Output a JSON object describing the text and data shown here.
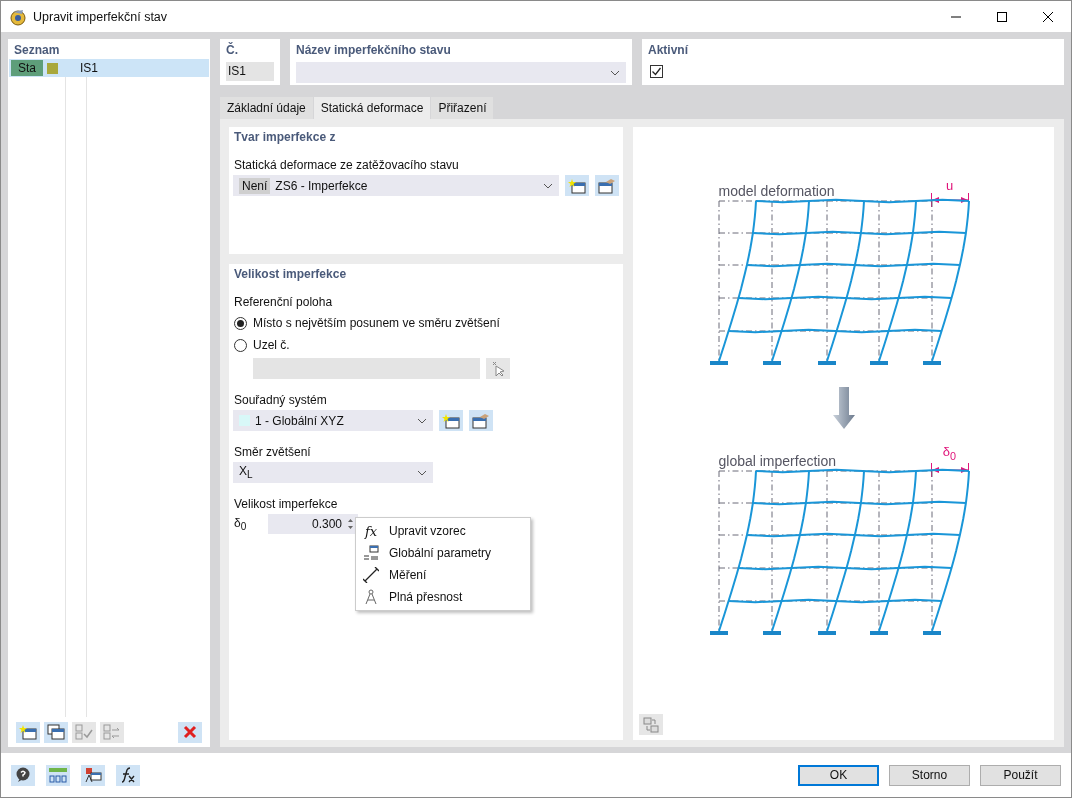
{
  "window": {
    "title": "Upravit imperfekční stav"
  },
  "list": {
    "title": "Seznam",
    "items": [
      {
        "tag": "Sta",
        "color": "#a9a83c",
        "name": "IS1",
        "selected": true
      }
    ]
  },
  "number": {
    "label": "Č.",
    "value": "IS1"
  },
  "name_field": {
    "label": "Název imperfekčního stavu"
  },
  "active": {
    "label": "Aktivní",
    "checked": true
  },
  "tabs": [
    {
      "label": "Základní údaje",
      "selected": false
    },
    {
      "label": "Statická deformace",
      "selected": true
    },
    {
      "label": "Přiřazení",
      "selected": false
    }
  ],
  "shape_section": {
    "title": "Tvar imperfekce z",
    "field_label": "Statická deformace ze zatěžovacího stavu",
    "tag": "Není",
    "value": "ZS6 - Imperfekce"
  },
  "size_section": {
    "title": "Velikost imperfekce",
    "reference_label": "Referenční poloha",
    "options": [
      {
        "label": "Místo s největším posunem ve směru zvětšení",
        "selected": true
      },
      {
        "label": "Uzel č.",
        "selected": false
      }
    ],
    "coord_label": "Souřadný systém",
    "coord_value": "1 - Globální XYZ",
    "direction_label": "Směr zvětšení",
    "direction_value": "X$_{L}$",
    "magnitude_label": "Velikost imperfekce",
    "symbol": "δ$_{0}$",
    "value": "0.300"
  },
  "context_menu": [
    {
      "kind": "formula",
      "symbol": "fx",
      "label": "Upravit vzorec"
    },
    {
      "kind": "parameters",
      "label": "Globální parametry"
    },
    {
      "kind": "measure",
      "label": "Měření"
    },
    {
      "kind": "precision",
      "label": "Plná přesnost"
    }
  ],
  "diagrams": [
    {
      "caption": "model deformation",
      "dimension": "u"
    },
    {
      "caption": "global imperfection",
      "dimension": "δ$_{0}$"
    }
  ],
  "buttons": [
    {
      "label": "OK",
      "default": true
    },
    {
      "label": "Storno",
      "default": false
    },
    {
      "label": "Použít",
      "default": false
    }
  ]
}
